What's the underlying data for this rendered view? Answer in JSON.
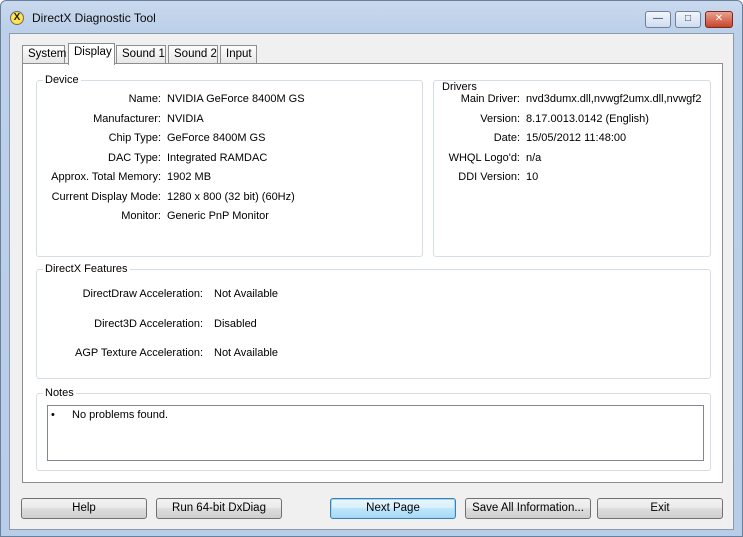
{
  "window": {
    "title": "DirectX Diagnostic Tool",
    "icon": "directx-x-icon",
    "app_icon_glyph": "X",
    "controls": {
      "minimize": "minimize-icon",
      "maximize": "maximize-icon",
      "close": "close-icon",
      "minimize_glyph": "—",
      "maximize_glyph": "□",
      "close_glyph": "✕"
    }
  },
  "tabs": [
    {
      "label": "System",
      "active": false
    },
    {
      "label": "Display",
      "active": true
    },
    {
      "label": "Sound 1",
      "active": false
    },
    {
      "label": "Sound 2",
      "active": false
    },
    {
      "label": "Input",
      "active": false
    }
  ],
  "device": {
    "heading": "Device",
    "fields": [
      {
        "label": "Name:",
        "value": "NVIDIA GeForce 8400M GS"
      },
      {
        "label": "Manufacturer:",
        "value": "NVIDIA"
      },
      {
        "label": "Chip Type:",
        "value": "GeForce 8400M GS"
      },
      {
        "label": "DAC Type:",
        "value": "Integrated RAMDAC"
      },
      {
        "label": "Approx. Total Memory:",
        "value": "1902 MB"
      },
      {
        "label": "Current Display Mode:",
        "value": "1280 x 800 (32 bit) (60Hz)"
      },
      {
        "label": "Monitor:",
        "value": "Generic PnP Monitor"
      }
    ]
  },
  "drivers": {
    "heading": "Drivers",
    "fields": [
      {
        "label": "Main Driver:",
        "value": "nvd3dumx.dll,nvwgf2umx.dll,nvwgf2"
      },
      {
        "label": "Version:",
        "value": "8.17.0013.0142 (English)"
      },
      {
        "label": "Date:",
        "value": "15/05/2012 11:48:00"
      },
      {
        "label": "WHQL Logo'd:",
        "value": "n/a"
      },
      {
        "label": "DDI Version:",
        "value": "10"
      }
    ]
  },
  "features": {
    "heading": "DirectX Features",
    "fields": [
      {
        "label": "DirectDraw Acceleration:",
        "value": "Not Available"
      },
      {
        "label": "Direct3D Acceleration:",
        "value": "Disabled"
      },
      {
        "label": "AGP Texture Acceleration:",
        "value": "Not Available"
      }
    ]
  },
  "notes": {
    "heading": "Notes",
    "items": [
      "No problems found."
    ],
    "bullet": "•"
  },
  "buttons": {
    "help": "Help",
    "run64": "Run 64-bit DxDiag",
    "next": "Next Page",
    "save": "Save All Information...",
    "exit": "Exit"
  },
  "colors": {
    "title_bar": "#c9d9ee",
    "close_button": "#c8442a",
    "default_button_border": "#3c7fb1"
  }
}
